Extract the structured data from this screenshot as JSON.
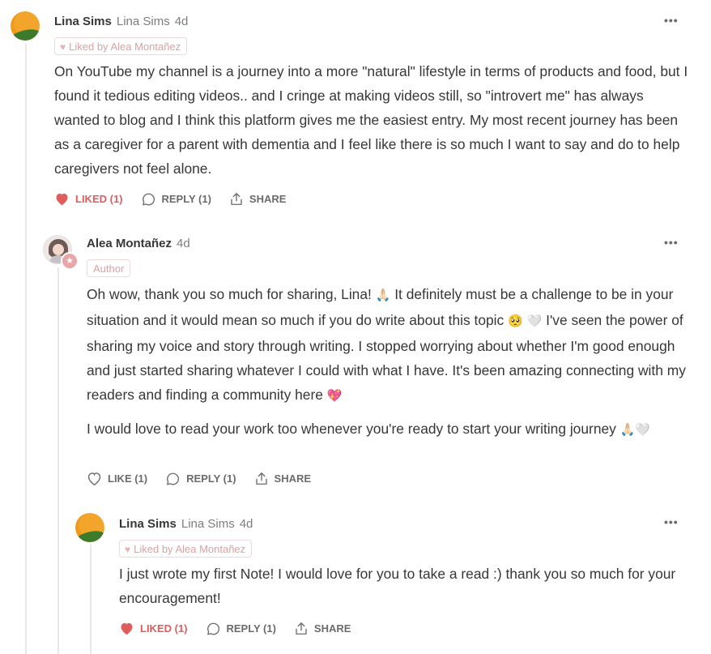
{
  "comments": [
    {
      "name": "Lina Sims",
      "handle": "Lina Sims",
      "time": "4d",
      "liked_by": "Liked by Alea Montañez",
      "body": "On YouTube my channel is a journey into a more \"natural\" lifestyle in terms of products and food, but I found it tedious editing videos.. and I cringe at making videos still, so \"introvert me\" has always wanted to blog and I think this platform gives me the easiest entry. My most recent journey has been as a caregiver for a parent with dementia and I feel like there is so much I want to say and do to help caregivers not feel alone.",
      "like_label": "LIKED (1)",
      "reply_label": "REPLY (1)",
      "share_label": "SHARE"
    },
    {
      "name": "Alea Montañez",
      "time": "4d",
      "author_badge": "Author",
      "body_p1_a": "Oh wow, thank you so much for sharing, Lina! ",
      "body_p1_b": " It definitely must be a challenge to be in your situation and it would mean so much if you do write about this topic ",
      "body_p1_c": " I've seen the power of sharing my voice and story through writing. I stopped worrying about whether I'm good enough and just started sharing whatever I could with what I have. It's been amazing connecting with my readers and finding a community here ",
      "body_p2": "I would love to read your work too whenever you're ready to start your writing journey ",
      "emoji_pray": "🙏🏻",
      "emoji_pleading": "🥺",
      "emoji_white_heart": "🤍",
      "emoji_sparkle_heart": "💖",
      "like_label": "LIKE (1)",
      "reply_label": "REPLY (1)",
      "share_label": "SHARE"
    },
    {
      "name": "Lina Sims",
      "handle": "Lina Sims",
      "time": "4d",
      "liked_by": "Liked by Alea Montañez",
      "body": "I just wrote my first Note! I would love for you to take a read :) thank you so much for your encouragement!",
      "like_label": "LIKED (1)",
      "reply_label": "REPLY (1)",
      "share_label": "SHARE"
    }
  ],
  "more_label": "•••",
  "colors": {
    "liked": "#e05d5d",
    "pill_border": "#eadada",
    "pill_text": "#d7a3a3",
    "thread": "#e8e8e8"
  }
}
